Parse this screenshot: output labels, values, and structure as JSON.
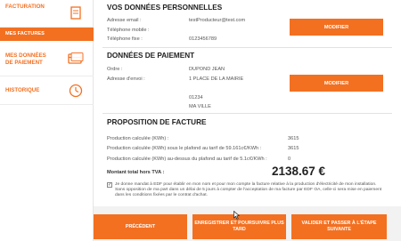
{
  "sidebar": {
    "top_item": "FACTURATION",
    "sub_item": "MES FACTURES",
    "items": [
      {
        "label": "MES DONNÉES DE PAIEMENT",
        "icon": "card-icon"
      },
      {
        "label": "HISTORIQUE",
        "icon": "clock-icon"
      }
    ]
  },
  "personal": {
    "title": "VOS DONNÉES PERSONNELLES",
    "email_label": "Adresse email :",
    "email_value": "testProducteur@test.com",
    "mobile_label": "Téléphone mobile :",
    "phone_label": "Téléphone fixe :",
    "phone_value": "0123456789",
    "modify_label": "MODIFIER"
  },
  "payment": {
    "title": "DONNÉES DE PAIEMENT",
    "order_label": "Ordre :",
    "order_value": "DUPOND JEAN",
    "address_label": "Adresse d'envoi :",
    "address_line1": "1 PLACE DE LA MAIRIE",
    "postcode": "01234",
    "city": "MA VILLE",
    "modify_label": "MODIFIER"
  },
  "invoice": {
    "title": "PROPOSITION DE FACTURE",
    "rows": [
      {
        "label": "Production calculée (KWh) :",
        "value": "3615"
      },
      {
        "label": "Production calculée (KWh) sous le plafond au tarif de 59.161c€/KWh :",
        "value": "3615"
      },
      {
        "label": "Production calculée (KWh) au-dessus du plafond au tarif de 5.1c€/KWh :",
        "value": "0"
      }
    ],
    "total_label": "Montant total hors TVA :",
    "total_value": "2138.67 €",
    "checkbox_mark": "✓",
    "mandate_text": "Je donne mandat à EDF pour établir en mon nom et pour mon compte la facture relative à la production d'électricité de mon installation. Sans opposition de ma part dans un délai de 5 jours à compter de l'acceptation de ma facture par EDF OA, celle-ci sera mise en paiement dans les conditions fixées par le contrat d'achat."
  },
  "actions": {
    "previous": "PRÉCÉDENT",
    "save": "ENREGISTRER ET POURSUIVRE PLUS TARD",
    "validate": "VALIDER ET PASSER À L'ÉTAPE SUIVANTE"
  },
  "colors": {
    "accent": "#f37021"
  }
}
